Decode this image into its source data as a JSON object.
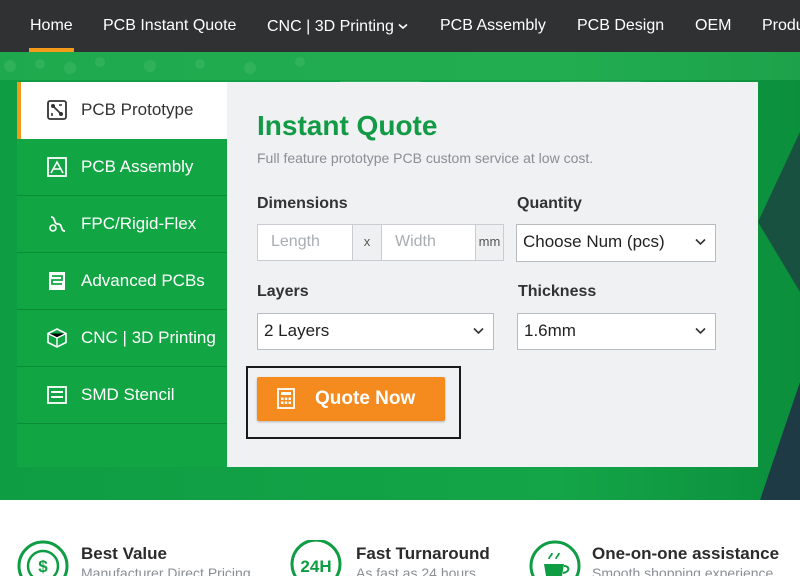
{
  "nav": {
    "items": [
      {
        "label": "Home",
        "active": true
      },
      {
        "label": "PCB Instant Quote"
      },
      {
        "label": "CNC | 3D Printing",
        "caret": "⌄"
      },
      {
        "label": "PCB Assembly"
      },
      {
        "label": "PCB Design"
      },
      {
        "label": "OEM"
      },
      {
        "label": "Produ"
      }
    ]
  },
  "tabs": [
    {
      "label": "PCB Prototype",
      "icon": "pcb-icon"
    },
    {
      "label": "PCB Assembly",
      "icon": "assembly-icon"
    },
    {
      "label": "FPC/Rigid-Flex",
      "icon": "flex-icon"
    },
    {
      "label": "Advanced PCBs",
      "icon": "advanced-pcb-icon"
    },
    {
      "label": "CNC | 3D Printing",
      "icon": "cube-3d-icon"
    },
    {
      "label": "SMD Stencil",
      "icon": "stencil-icon"
    }
  ],
  "quote": {
    "title": "Instant Quote",
    "subtitle": "Full feature prototype PCB custom service at low cost.",
    "dimensions_label": "Dimensions",
    "length_placeholder": "Length",
    "times": "x",
    "width_placeholder": "Width",
    "unit": "mm",
    "quantity_label": "Quantity",
    "quantity_value": "Choose Num (pcs)",
    "layers_label": "Layers",
    "layers_value": "2 Layers",
    "thickness_label": "Thickness",
    "thickness_value": "1.6mm",
    "button_label": "Quote Now"
  },
  "features": [
    {
      "title": "Best Value",
      "subtitle": "Manufacturer Direct Pricing",
      "icon": "dollar-icon"
    },
    {
      "title": "Fast Turnaround",
      "subtitle": "As fast as 24 hours",
      "badge": "24H",
      "icon": "clock-24h-icon"
    },
    {
      "title": "One-on-one assistance",
      "subtitle": "Smooth shopping experience",
      "icon": "coffee-cup-icon"
    }
  ],
  "colors": {
    "nav_bg": "#2f3132",
    "accent": "#f39a1a",
    "brand_green": "#129a45",
    "button": "#f58a1f"
  }
}
